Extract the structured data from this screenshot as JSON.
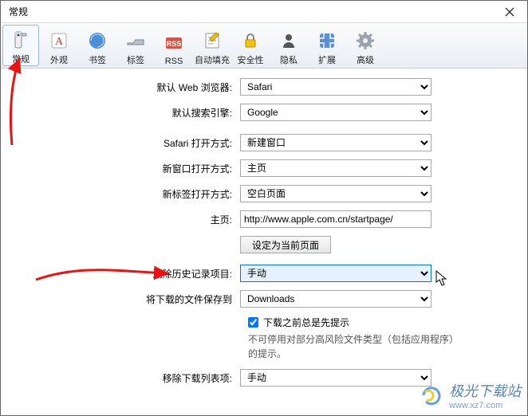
{
  "window": {
    "title": "常规"
  },
  "toolbar": {
    "items": [
      {
        "key": "general",
        "label": "常规"
      },
      {
        "key": "appearance",
        "label": "外观"
      },
      {
        "key": "bookmarks",
        "label": "书签"
      },
      {
        "key": "tabs",
        "label": "标签"
      },
      {
        "key": "rss",
        "label": "RSS"
      },
      {
        "key": "autofill",
        "label": "自动填充"
      },
      {
        "key": "security",
        "label": "安全性"
      },
      {
        "key": "privacy",
        "label": "隐私"
      },
      {
        "key": "extensions",
        "label": "扩展"
      },
      {
        "key": "advanced",
        "label": "高级"
      }
    ]
  },
  "form": {
    "default_browser_label": "默认 Web 浏览器:",
    "default_browser_value": "Safari",
    "default_search_label": "默认搜索引擎:",
    "default_search_value": "Google",
    "safari_open_label": "Safari 打开方式:",
    "safari_open_value": "新建窗口",
    "new_window_label": "新窗口打开方式:",
    "new_window_value": "主页",
    "new_tab_label": "新标签打开方式:",
    "new_tab_value": "空白页面",
    "homepage_label": "主页:",
    "homepage_value": "http://www.apple.com.cn/startpage/",
    "set_current_button": "设定为当前页面",
    "remove_history_label": "删除历史记录项目:",
    "remove_history_value": "手动",
    "save_downloads_label": "将下载的文件保存到",
    "save_downloads_value": "Downloads",
    "prompt_before_download_label": "下载之前总是先提示",
    "prompt_before_download_checked": true,
    "download_note": "不可停用对部分高风险文件类型（包括应用程序）的提示。",
    "remove_download_list_label": "移除下载列表项:",
    "remove_download_list_value": "手动"
  },
  "watermark": {
    "brand": "极光下载站",
    "url": "www.xz7.com"
  }
}
